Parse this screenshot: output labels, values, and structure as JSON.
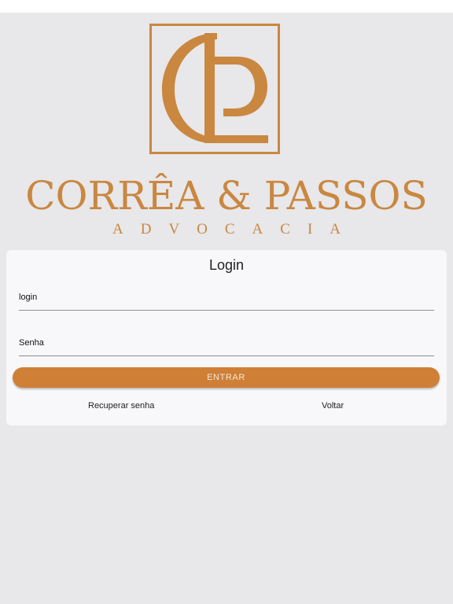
{
  "logo": {
    "monogram_letters": "CP",
    "firm_name": "CORRÊA & PASSOS",
    "firm_subtitle": "ADVOCACIA"
  },
  "login": {
    "title": "Login",
    "login_placeholder": "login",
    "password_placeholder": "Senha",
    "submit_label": "ENTRAR",
    "recover_label": "Recuperar senha",
    "back_label": "Voltar"
  },
  "colors": {
    "brand": "#cf8036",
    "background": "#e8e7ea",
    "card": "#f8f7f9"
  }
}
